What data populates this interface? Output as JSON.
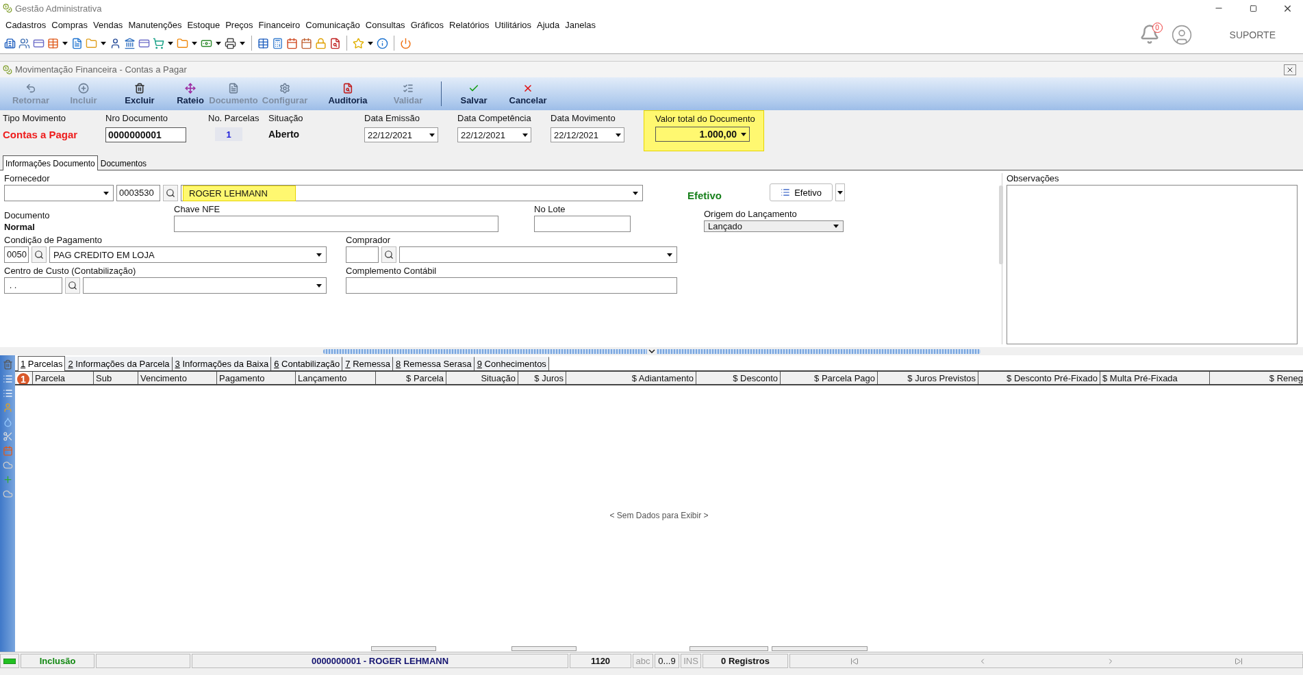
{
  "app": {
    "title": "Gestão Administrativa",
    "user": "SUPORTE",
    "notification_count": "0"
  },
  "menu": [
    "Cadastros",
    "Compras",
    "Vendas",
    "Manutenções",
    "Estoque",
    "Preços",
    "Financeiro",
    "Comunicação",
    "Consultas",
    "Gráficos",
    "Relatórios",
    "Utilitários",
    "Ajuda",
    "Janelas"
  ],
  "form": {
    "title": "Movimentação Financeira - Contas a Pagar",
    "toolbar": [
      {
        "label": "Retornar",
        "disabled": true
      },
      {
        "label": "Incluir",
        "disabled": true
      },
      {
        "label": "Excluir",
        "disabled": false
      },
      {
        "label": "Rateio",
        "disabled": false
      },
      {
        "label": "Documento",
        "disabled": true
      },
      {
        "label": "Configurar",
        "disabled": true
      },
      {
        "label": "Auditoria",
        "disabled": false
      },
      {
        "label": "Validar",
        "disabled": true
      },
      {
        "label": "Salvar",
        "disabled": false
      },
      {
        "label": "Cancelar",
        "disabled": false
      }
    ],
    "header": {
      "tipo_movimento": {
        "label": "Tipo Movimento",
        "value": "Contas a Pagar"
      },
      "nro_documento": {
        "label": "Nro Documento",
        "value": "0000000001"
      },
      "no_parcelas": {
        "label": "No. Parcelas",
        "value": "1"
      },
      "situacao": {
        "label": "Situação",
        "value": "Aberto"
      },
      "datas": [
        {
          "label": "Data Emissão",
          "value": "22/12/2021"
        },
        {
          "label": "Data Competência",
          "value": "22/12/2021"
        },
        {
          "label": "Data Movimento",
          "value": "22/12/2021"
        }
      ],
      "valor_total": {
        "label": "Valor total do Documento",
        "value": "1.000,00",
        "highlighted": true
      }
    }
  },
  "tabs": [
    {
      "label": "Informações Documento",
      "selected": true
    },
    {
      "label": "Documentos",
      "selected": false
    }
  ],
  "fields": {
    "fornecedor": {
      "label": "Fornecedor",
      "code": "0003530",
      "name": "ROGER LEHMANN",
      "highlighted": true
    },
    "status": "Efetivo",
    "efetivo_button": "Efetivo",
    "documento": {
      "label": "Documento",
      "value": "Normal"
    },
    "chave_nfe": {
      "label": "Chave NFE"
    },
    "no_lote": {
      "label": "No Lote"
    },
    "origem": {
      "label": "Origem do Lançamento",
      "value": "Lançado"
    },
    "condicao": {
      "label": "Condição de Pagamento",
      "code": "0050",
      "value": "PAG CREDITO EM LOJA"
    },
    "comprador": {
      "label": "Comprador"
    },
    "centro_custo": {
      "label": "Centro de Custo (Contabilização)",
      "value": ". ."
    },
    "complemento": {
      "label": "Complemento Contábil"
    }
  },
  "observacoes": {
    "label": "Observações"
  },
  "detail_tabs": [
    {
      "number": "1",
      "label": "Parcelas",
      "selected": true
    },
    {
      "number": "2",
      "label": "Informações da Parcela",
      "selected": false
    },
    {
      "number": "3",
      "label": "Informações da Baixa",
      "selected": false
    },
    {
      "number": "6",
      "label": "Contabilização",
      "selected": false
    },
    {
      "number": "7",
      "label": "Remessa",
      "selected": false
    },
    {
      "number": "8",
      "label": "Remessa Serasa",
      "selected": false
    },
    {
      "number": "9",
      "label": "Conhecimentos",
      "selected": false
    }
  ],
  "grid": {
    "annotation": "1",
    "columns": [
      "Parcela",
      "Sub",
      "Vencimento",
      "Pagamento",
      "Lançamento",
      "$ Parcela",
      "Situação",
      "$ Juros",
      "$ Adiantamento",
      "$ Desconto",
      "$ Parcela Pago",
      "$ Juros Previstos",
      "$ Desconto Pré-Fixado",
      "$ Multa Pré-Fixada",
      "$ Reneg"
    ],
    "empty_text": "< Sem Dados para Exibir >"
  },
  "status_bar": {
    "mode": "Inclusão",
    "document": "0000000001 - ROGER LEHMANN",
    "code": "1120",
    "indicators": [
      "abc",
      "0...9",
      "INS"
    ],
    "records": "0 Registros"
  }
}
